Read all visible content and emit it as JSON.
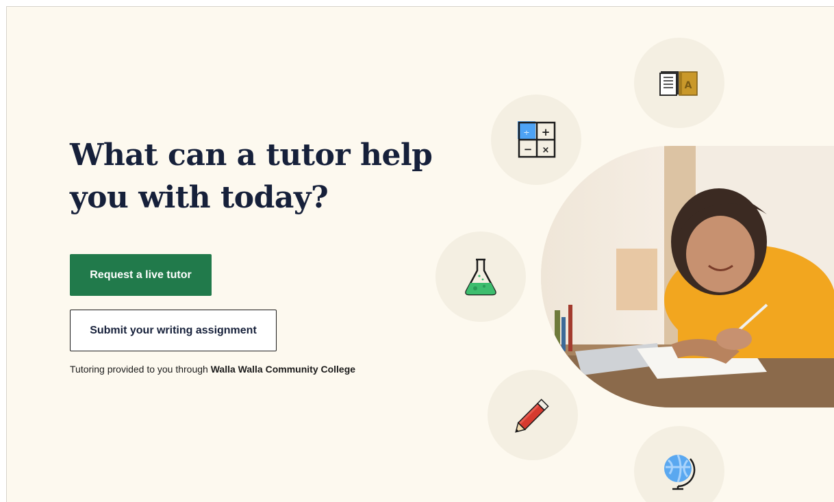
{
  "hero": {
    "title": "What can a tutor help you with today?",
    "primary_button": "Request a live tutor",
    "secondary_button": "Submit your writing assignment",
    "provided_prefix": "Tutoring provided to you through ",
    "institution": "Walla Walla Community College"
  },
  "icons": [
    "books-icon",
    "calculator-icon",
    "flask-icon",
    "pencil-icon",
    "globe-icon"
  ],
  "colors": {
    "background": "#fdf9ef",
    "primary": "#217a4b",
    "heading": "#16203a",
    "circle": "#f4efe2"
  }
}
